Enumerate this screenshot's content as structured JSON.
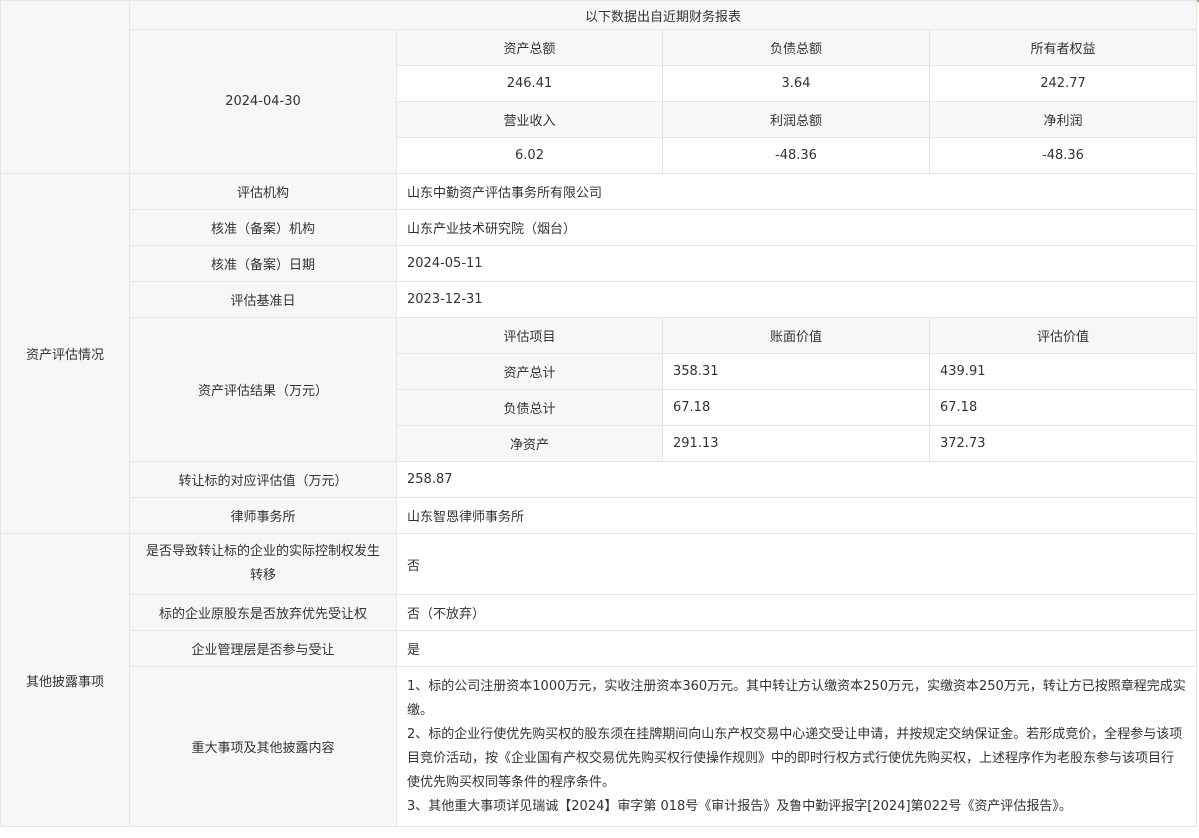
{
  "financial": {
    "notice": "以下数据出自近期财务报表",
    "date": "2024-04-30",
    "headers_row1": [
      "资产总额",
      "负债总额",
      "所有者权益"
    ],
    "values_row1": [
      "246.41",
      "3.64",
      "242.77"
    ],
    "headers_row2": [
      "营业收入",
      "利润总额",
      "净利润"
    ],
    "values_row2": [
      "6.02",
      "-48.36",
      "-48.36"
    ]
  },
  "valuation": {
    "category": "资产评估情况",
    "agency_label": "评估机构",
    "agency_value": "山东中勤资产评估事务所有限公司",
    "approval_org_label": "核准（备案）机构",
    "approval_org_value": "山东产业技术研究院（烟台）",
    "approval_date_label": "核准（备案）日期",
    "approval_date_value": "2024-05-11",
    "base_date_label": "评估基准日",
    "base_date_value": "2023-12-31",
    "result_label": "资产评估结果（万元）",
    "result_headers": [
      "评估项目",
      "账面价值",
      "评估价值"
    ],
    "result_rows": [
      {
        "item": "资产总计",
        "book": "358.31",
        "appraised": "439.91"
      },
      {
        "item": "负债总计",
        "book": "67.18",
        "appraised": "67.18"
      },
      {
        "item": "净资产",
        "book": "291.13",
        "appraised": "372.73"
      }
    ],
    "transfer_value_label": "转让标的对应评估值（万元）",
    "transfer_value": "258.87",
    "law_firm_label": "律师事务所",
    "law_firm_value": "山东智恩律师事务所"
  },
  "other": {
    "category": "其他披露事项",
    "control_change_label": "是否导致转让标的企业的实际控制权发生转移",
    "control_change_value": "否",
    "preemptive_label": "标的企业原股东是否放弃优先受让权",
    "preemptive_value": "否（不放弃）",
    "management_label": "企业管理层是否参与受让",
    "management_value": "是",
    "major_label": "重大事项及其他披露内容",
    "major_items": [
      "1、标的公司注册资本1000万元，实收注册资本360万元。其中转让方认缴资本250万元，实缴资本250万元，转让方已按照章程完成实缴。",
      "2、标的企业行使优先购买权的股东须在挂牌期间向山东产权交易中心递交受让申请，并按规定交纳保证金。若形成竞价，全程参与该项目竞价活动，按《企业国有产权交易优先购买权行使操作规则》中的即时行权方式行使优先购买权，上述程序作为老股东参与该项目行使优先购买权同等条件的程序条件。",
      "3、其他重大事项详见瑞诚【2024】审字第 018号《审计报告》及鲁中勤评报字[2024]第022号《资产评估报告》。"
    ]
  }
}
